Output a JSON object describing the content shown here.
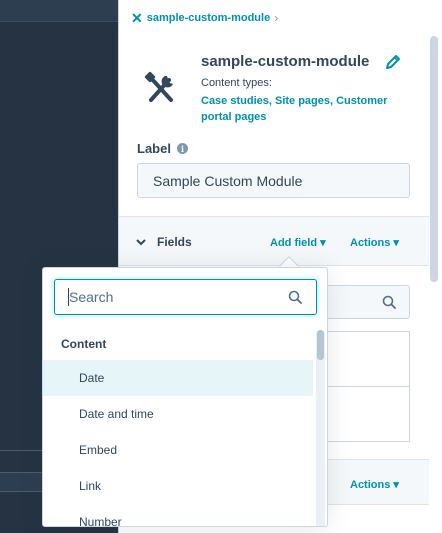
{
  "sidebar": {
    "breadcrumb": {
      "label": "sample-custom-module"
    },
    "module": {
      "title": "sample-custom-module",
      "content_types_label": "Content types:",
      "content_types_value": "Case studies, Site pages, Customer portal pages"
    },
    "label_section": {
      "title": "Label",
      "value": "Sample Custom Module"
    },
    "fields_section": {
      "title": "Fields",
      "add_field": "Add field",
      "actions": "Actions"
    },
    "lower_bar": {
      "actions": "Actions"
    }
  },
  "popover": {
    "search_placeholder": "Search",
    "group_header": "Content",
    "options": [
      "Date",
      "Date and time",
      "Embed",
      "Link",
      "Number"
    ],
    "active_option": "Date"
  },
  "colors": {
    "accent": "#0091ae",
    "dark_panel": "#253342",
    "text": "#33475b",
    "highlight": "#e5f5f8"
  }
}
